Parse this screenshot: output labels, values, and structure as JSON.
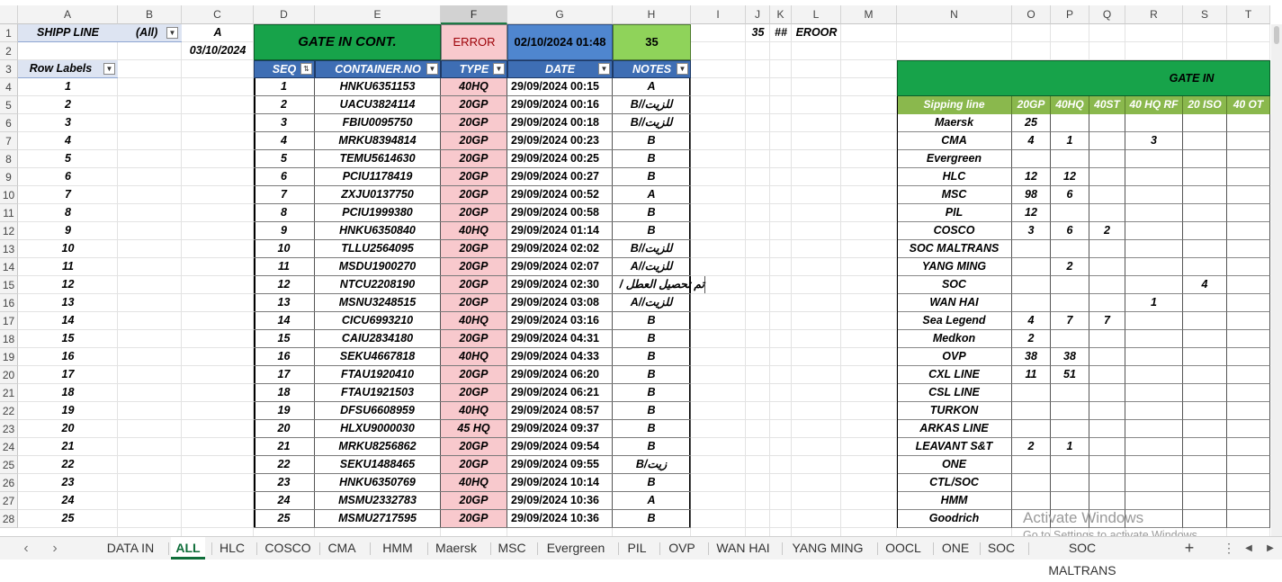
{
  "columns": [
    "A",
    "B",
    "C",
    "D",
    "E",
    "F",
    "G",
    "H",
    "I",
    "J",
    "K",
    "L",
    "M",
    "N",
    "O",
    "P",
    "Q",
    "R",
    "S",
    "T"
  ],
  "rows": [
    "1",
    "2",
    "3",
    "4",
    "5",
    "6",
    "7",
    "8",
    "9",
    "10",
    "11",
    "12",
    "13",
    "14",
    "15",
    "16",
    "17",
    "18",
    "19",
    "20",
    "21",
    "22",
    "23",
    "24",
    "25",
    "26",
    "27",
    "28"
  ],
  "pivot": {
    "filter_label": "SHIPP LINE",
    "filter_value": "(All)",
    "c1": "A",
    "c2": "03/10/2024",
    "row_labels": "Row Labels",
    "values": [
      "1",
      "2",
      "3",
      "4",
      "5",
      "6",
      "7",
      "8",
      "9",
      "10",
      "11",
      "12",
      "13",
      "14",
      "15",
      "16",
      "17",
      "18",
      "19",
      "20",
      "21",
      "22",
      "23",
      "24",
      "25"
    ]
  },
  "banner": {
    "title": "GATE IN CONT.",
    "error": "ERROR",
    "datetime": "02/10/2024 01:48",
    "count": "35"
  },
  "side_top": {
    "j1": "35",
    "k1": "##",
    "l1": "EROOR"
  },
  "table": {
    "headers": [
      "SEQ",
      "CONTAINER.NO",
      "TYPE",
      "DATE",
      "NOTES"
    ],
    "rows": [
      [
        "1",
        "HNKU6351153",
        "40HQ",
        "29/09/2024 00:15",
        "A"
      ],
      [
        "2",
        "UACU3824114",
        "20GP",
        "29/09/2024 00:16",
        "للزيت//B"
      ],
      [
        "3",
        "FBIU0095750",
        "20GP",
        "29/09/2024 00:18",
        "للزيت//B"
      ],
      [
        "4",
        "MRKU8394814",
        "20GP",
        "29/09/2024 00:23",
        "B"
      ],
      [
        "5",
        "TEMU5614630",
        "20GP",
        "29/09/2024 00:25",
        "B"
      ],
      [
        "6",
        "PCIU1178419",
        "20GP",
        "29/09/2024 00:27",
        "B"
      ],
      [
        "7",
        "ZXJU0137750",
        "20GP",
        "29/09/2024 00:52",
        "A"
      ],
      [
        "8",
        "PCIU1999380",
        "20GP",
        "29/09/2024 00:58",
        "B"
      ],
      [
        "9",
        "HNKU6350840",
        "40HQ",
        "29/09/2024 01:14",
        "B"
      ],
      [
        "10",
        "TLLU2564095",
        "20GP",
        "29/09/2024 02:02",
        "للزيت//B"
      ],
      [
        "11",
        "MSDU1900270",
        "20GP",
        "29/09/2024 02:07",
        "للزيت//A"
      ],
      [
        "12",
        "NTCU2208190",
        "20GP",
        "29/09/2024 02:30",
        "تم تحصيل العطل /"
      ],
      [
        "13",
        "MSNU3248515",
        "20GP",
        "29/09/2024 03:08",
        "للزيت//A"
      ],
      [
        "14",
        "CICU6993210",
        "40HQ",
        "29/09/2024 03:16",
        "B"
      ],
      [
        "15",
        "CAIU2834180",
        "20GP",
        "29/09/2024 04:31",
        "B"
      ],
      [
        "16",
        "SEKU4667818",
        "40HQ",
        "29/09/2024 04:33",
        "B"
      ],
      [
        "17",
        "FTAU1920410",
        "20GP",
        "29/09/2024 06:20",
        "B"
      ],
      [
        "18",
        "FTAU1921503",
        "20GP",
        "29/09/2024 06:21",
        "B"
      ],
      [
        "19",
        "DFSU6608959",
        "40HQ",
        "29/09/2024 08:57",
        "B"
      ],
      [
        "20",
        "HLXU9000030",
        "45 HQ",
        "29/09/2024 09:37",
        "B"
      ],
      [
        "21",
        "MRKU8256862",
        "20GP",
        "29/09/2024 09:54",
        "B"
      ],
      [
        "22",
        "SEKU1488465",
        "20GP",
        "29/09/2024 09:55",
        "زيت/B"
      ],
      [
        "23",
        "HNKU6350769",
        "40HQ",
        "29/09/2024 10:14",
        "B"
      ],
      [
        "24",
        "MSMU2332783",
        "20GP",
        "29/09/2024 10:36",
        "A"
      ],
      [
        "25",
        "MSMU2717595",
        "20GP",
        "29/09/2024 10:36",
        "B"
      ]
    ]
  },
  "gate_in": {
    "title": "GATE IN",
    "headers": [
      "Sipping line",
      "20GP",
      "40HQ",
      "40ST",
      "40 HQ RF",
      "20 ISO",
      "40 OT"
    ],
    "rows": [
      [
        "Maersk",
        "25",
        "",
        "",
        "",
        "",
        ""
      ],
      [
        "CMA",
        "4",
        "1",
        "",
        "3",
        "",
        ""
      ],
      [
        "Evergreen",
        "",
        "",
        "",
        "",
        "",
        ""
      ],
      [
        "HLC",
        "12",
        "12",
        "",
        "",
        "",
        ""
      ],
      [
        "MSC",
        "98",
        "6",
        "",
        "",
        "",
        ""
      ],
      [
        "PIL",
        "12",
        "",
        "",
        "",
        "",
        ""
      ],
      [
        "COSCO",
        "3",
        "6",
        "2",
        "",
        "",
        ""
      ],
      [
        "SOC MALTRANS",
        "",
        "",
        "",
        "",
        "",
        ""
      ],
      [
        "YANG MING",
        "",
        "2",
        "",
        "",
        "",
        ""
      ],
      [
        "SOC",
        "",
        "",
        "",
        "",
        "4",
        ""
      ],
      [
        "WAN HAI",
        "",
        "",
        "",
        "1",
        "",
        ""
      ],
      [
        "Sea Legend",
        "4",
        "7",
        "7",
        "",
        "",
        ""
      ],
      [
        "Medkon",
        "2",
        "",
        "",
        "",
        "",
        ""
      ],
      [
        "OVP",
        "38",
        "38",
        "",
        "",
        "",
        ""
      ],
      [
        "CXL LINE",
        "11",
        "51",
        "",
        "",
        "",
        ""
      ],
      [
        "CSL LINE",
        "",
        "",
        "",
        "",
        "",
        ""
      ],
      [
        "TURKON",
        "",
        "",
        "",
        "",
        "",
        ""
      ],
      [
        "ARKAS LINE",
        "",
        "",
        "",
        "",
        "",
        ""
      ],
      [
        "LEAVANT S&T",
        "2",
        "1",
        "",
        "",
        "",
        ""
      ],
      [
        "ONE",
        "",
        "",
        "",
        "",
        "",
        ""
      ],
      [
        "CTL/SOC",
        "",
        "",
        "",
        "",
        "",
        ""
      ],
      [
        "HMM",
        "",
        "",
        "",
        "",
        "",
        ""
      ],
      [
        "Goodrich",
        "",
        "",
        "",
        "",
        "",
        ""
      ]
    ]
  },
  "watermark": {
    "line1": "Activate Windows",
    "line2": "Go to Settings to activate Windows."
  },
  "tabs": [
    "DATA IN",
    "ALL",
    "HLC",
    "COSCO",
    "CMA",
    "HMM",
    "Maersk",
    "MSC",
    "Evergreen",
    "PIL",
    "OVP",
    "WAN HAI",
    "YANG MING",
    "OOCL",
    "ONE",
    "SOC",
    "SOC MALTRANS"
  ],
  "active_tab": "ALL",
  "icons": [
    "prev-sheet-icon",
    "next-sheet-icon",
    "add-sheet-icon",
    "more-options-icon",
    "scroll-left-icon",
    "scroll-right-icon"
  ]
}
